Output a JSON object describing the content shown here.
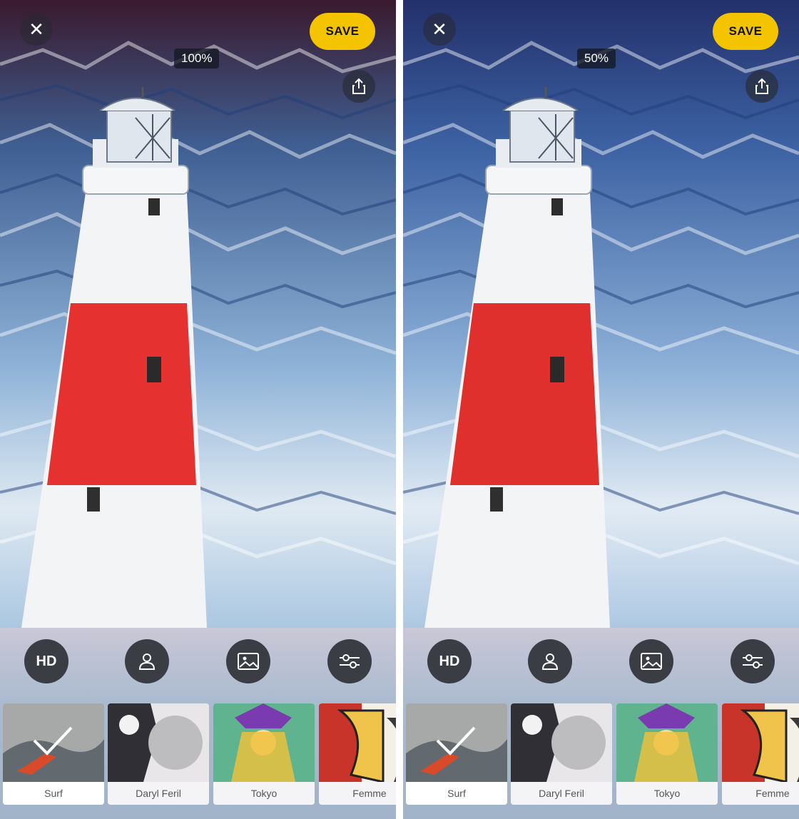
{
  "screens": [
    {
      "close_icon": "✕",
      "save_label": "SAVE",
      "intensity_label": "100%",
      "intensity": 1.0,
      "tools": [
        "HD",
        "person-icon",
        "image-icon",
        "sliders-icon"
      ],
      "filters": [
        {
          "label": "Surf",
          "selected": true
        },
        {
          "label": "Daryl Feril",
          "selected": false
        },
        {
          "label": "Tokyo",
          "selected": false
        },
        {
          "label": "Femme",
          "selected": false
        }
      ]
    },
    {
      "close_icon": "✕",
      "save_label": "SAVE",
      "intensity_label": "50%",
      "intensity": 0.5,
      "tools": [
        "HD",
        "person-icon",
        "image-icon",
        "sliders-icon"
      ],
      "filters": [
        {
          "label": "Surf",
          "selected": true
        },
        {
          "label": "Daryl Feril",
          "selected": false
        },
        {
          "label": "Tokyo",
          "selected": false
        },
        {
          "label": "Femme",
          "selected": false
        }
      ]
    }
  ],
  "colors": {
    "accent": "#f5c400",
    "sky_dark_left": "#3a1a2e",
    "sky_dark_right": "#23306b",
    "band_red": "#e5312f",
    "tool_bg": "#3a3d44"
  }
}
